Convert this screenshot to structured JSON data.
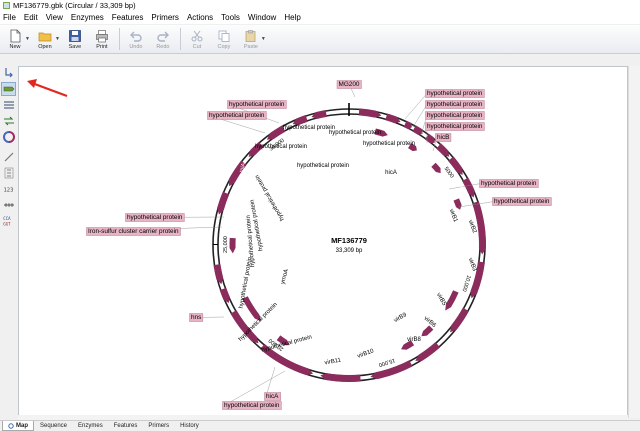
{
  "window": {
    "title": "MF136779.gbk  (Circular / 33,309 bp)"
  },
  "menu": [
    "File",
    "Edit",
    "View",
    "Enzymes",
    "Features",
    "Primers",
    "Actions",
    "Tools",
    "Window",
    "Help"
  ],
  "toolbar": {
    "new": "New",
    "open": "Open",
    "save": "Save",
    "print": "Print",
    "undo": "Undo",
    "redo": "Redo",
    "cut": "Cut",
    "copy": "Copy",
    "paste": "Paste"
  },
  "map": {
    "name": "MF136779",
    "length_label": "33,309 bp",
    "total_bp": 33309,
    "ticks": [
      {
        "bp": 5000,
        "label": "5000"
      },
      {
        "bp": 10000,
        "label": "10,000"
      },
      {
        "bp": 15000,
        "label": "15,000"
      },
      {
        "bp": 20000,
        "label": "20,000"
      },
      {
        "bp": 25000,
        "label": "25,000"
      },
      {
        "bp": 30000,
        "label": "30,000"
      }
    ],
    "feature_labels": [
      {
        "text": "MG200",
        "boxed": true
      },
      {
        "text": "hypothetical protein",
        "boxed": true
      },
      {
        "text": "hypothetical protein",
        "boxed": true
      },
      {
        "text": "hypothetical protein",
        "boxed": true
      },
      {
        "text": "hypothetical protein",
        "boxed": true
      },
      {
        "text": "hicB",
        "boxed": true
      },
      {
        "text": "hypothetical protein",
        "boxed": true
      },
      {
        "text": "hypothetical protein",
        "boxed": true
      },
      {
        "text": "hypothetical protein",
        "boxed": true
      },
      {
        "text": "hypothetical protein",
        "boxed": true
      },
      {
        "text": "hypothetical protein",
        "boxed": true
      },
      {
        "text": "Iron-sulfur cluster carrier protein",
        "boxed": true
      },
      {
        "text": "hns",
        "boxed": true
      },
      {
        "text": "hicA",
        "boxed": true
      },
      {
        "text": "hypothetical protein",
        "boxed": true
      }
    ],
    "inner_labels": [
      {
        "text": "hypothetical protein"
      },
      {
        "text": "hypothetical protein"
      },
      {
        "text": "hypothetical protein"
      },
      {
        "text": "hypothetical protein"
      },
      {
        "text": "hicA"
      },
      {
        "text": "virB1"
      },
      {
        "text": "virB2"
      },
      {
        "text": "virB3"
      },
      {
        "text": "virB5"
      },
      {
        "text": "virB6"
      },
      {
        "text": "virB8"
      },
      {
        "text": "virB9"
      },
      {
        "text": "virB10"
      },
      {
        "text": "virB11"
      },
      {
        "text": "hypothetical protein"
      },
      {
        "text": "hypothetical protein"
      },
      {
        "text": "hypothetical protein"
      },
      {
        "text": "hypothetical protein"
      },
      {
        "text": "hypothetical protein"
      },
      {
        "text": "hypothetical protein"
      },
      {
        "text": "ymoA"
      },
      {
        "text": "hypothetical protein"
      }
    ],
    "arrow_labels": [
      "traG",
      "traD",
      "virB4",
      "tpiA",
      "virB1",
      "hicA"
    ]
  },
  "tabs": [
    "Map",
    "Sequence",
    "Enzymes",
    "Features",
    "Primers",
    "History"
  ],
  "active_tab": "Map",
  "colors": {
    "feature": "#8b2c5c",
    "label_box": "#e8b4c4",
    "annotation_arrow": "#e0281e"
  }
}
